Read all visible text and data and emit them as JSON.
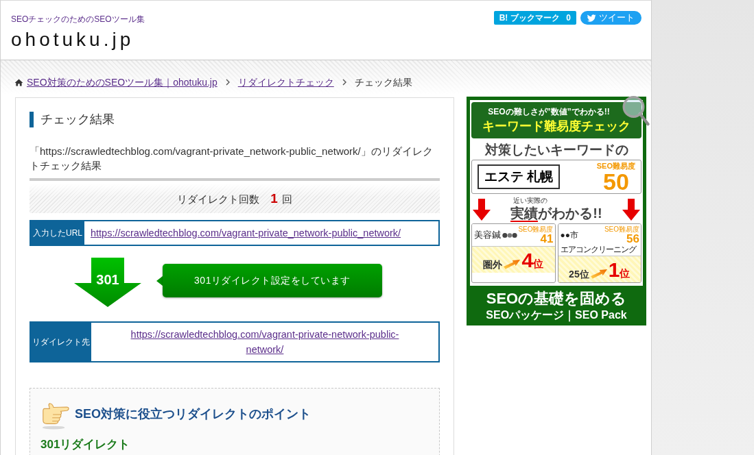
{
  "header": {
    "tagline": "SEOチェックのためのSEOツール集",
    "logo": "ohotuku.jp",
    "share_buttons": [
      {
        "kind": "hatena",
        "mark": "B!",
        "label": "ブックマーク",
        "count": "0"
      },
      {
        "kind": "twitter",
        "label": "ツイート"
      }
    ]
  },
  "breadcrumb": [
    {
      "label": "SEO対策のためのSEOツール集｜ohotuku.jp",
      "link": true
    },
    {
      "label": "リダイレクトチェック",
      "link": true
    },
    {
      "label": "チェック結果",
      "link": false
    }
  ],
  "result": {
    "title": "チェック結果",
    "description": "「https://scrawledtechblog.com/vagrant-private_network-public_network/」のリダイレクトチェック結果",
    "count_label": "リダイレクト回数",
    "count": "1",
    "count_unit": "回",
    "input": {
      "label": "入力したURL",
      "url": "https://scrawledtechblog.com/vagrant-private_network-public_network/"
    },
    "redirects": [
      {
        "code": "301",
        "message": "301リダイレクト設定をしています",
        "target_label": "リダイレクト先",
        "target_url": "https://scrawledtechblog.com/vagrant-private-network-public-network/"
      }
    ]
  },
  "tips": {
    "title": "SEO対策に役立つリダイレクトのポイント",
    "subheading": "301リダイレクト"
  },
  "ad": {
    "tagline": "SEOの難しさが”数値”でわかる!!",
    "title": "キーワード難易度チェック",
    "lead": "対策したいキーワードの",
    "keyword": "エステ 札幌",
    "score_label": "SEO難易度",
    "score": "50",
    "note": "近い実際の",
    "headline_highlight": "実績",
    "headline_rest": "がわかる!!",
    "examples": [
      {
        "keyword_lines": [
          "美容鍼"
        ],
        "masked": true,
        "score_label": "SEO難易度",
        "score": "41",
        "before": "圏外",
        "rank": "4",
        "rank_unit": "位"
      },
      {
        "keyword_lines": [
          "●●市",
          "エアコンクリーニング"
        ],
        "masked": false,
        "score_label": "SEO難易度",
        "score": "56",
        "before": "25位",
        "rank": "1",
        "rank_unit": "位"
      }
    ],
    "footer_title": "SEOの基礎を固める",
    "footer_subtitle": "SEOパッケージ｜SEO Pack"
  }
}
